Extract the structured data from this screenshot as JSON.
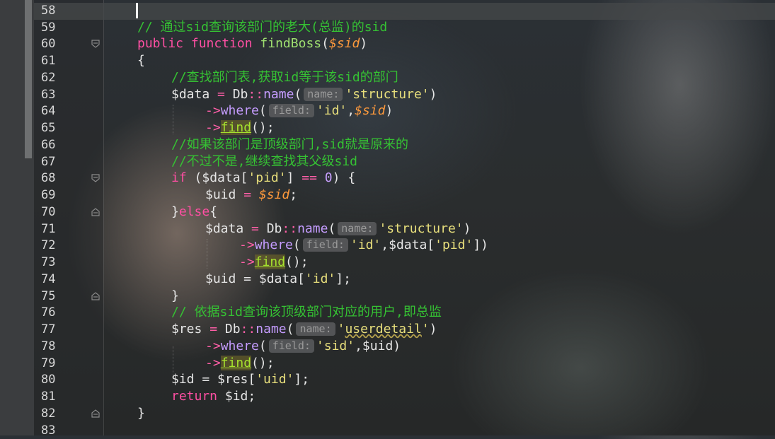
{
  "editor": {
    "line_numbers": [
      "58",
      "59",
      "60",
      "61",
      "62",
      "63",
      "64",
      "65",
      "66",
      "67",
      "68",
      "69",
      "70",
      "71",
      "72",
      "73",
      "74",
      "75",
      "76",
      "77",
      "78",
      "79",
      "80",
      "81",
      "82",
      "83"
    ],
    "code": {
      "l59": {
        "comment": "// 通过sid查询该部门的老大(总监)的sid"
      },
      "l60": {
        "kw1": "public",
        "kw2": "function",
        "name": "findBoss",
        "open": "(",
        "param": "$sid",
        "close": ")"
      },
      "l61": {
        "brace": "{"
      },
      "l62": {
        "comment": "//查找部门表,获取id等于该sid的部门"
      },
      "l63": {
        "var": "$data",
        "eq": " = ",
        "cls": "Db",
        "sep": "::",
        "method": "name",
        "open": "(",
        "hint": "name:",
        "arg": "'structure'",
        "close": ")"
      },
      "l64": {
        "arrow": "->",
        "method": "where",
        "open": "(",
        "hint": "field:",
        "arg": "'id'",
        "comma": ",",
        "param": "$sid",
        "close": ")"
      },
      "l65": {
        "arrow": "->",
        "method": "find",
        "rest": "();"
      },
      "l66": {
        "comment": "//如果该部门是顶级部门,sid就是原来的"
      },
      "l67": {
        "comment": "//不过不是,继续查找其父级sid"
      },
      "l68": {
        "kw": "if",
        "a": " ($data[",
        "str": "'pid'",
        "b": "] ",
        "op": "==",
        "c": " ",
        "num": "0",
        "d": ") {"
      },
      "l69": {
        "var": "$uid",
        "eq": " = ",
        "param": "$sid",
        "end": ";"
      },
      "l70": {
        "a": "}",
        "kw": "else",
        "b": "{"
      },
      "l71": {
        "var": "$data",
        "eq": " = ",
        "cls": "Db",
        "sep": "::",
        "method": "name",
        "open": "(",
        "hint": "name:",
        "arg": "'structure'",
        "close": ")"
      },
      "l72": {
        "arrow": "->",
        "method": "where",
        "open": "(",
        "hint": "field:",
        "arg": "'id'",
        "b": ",$data[",
        "arg2": "'pid'",
        "close": "])"
      },
      "l73": {
        "arrow": "->",
        "method": "find",
        "rest": "();"
      },
      "l74": {
        "a": "$uid = $data[",
        "str": "'id'",
        "b": "];"
      },
      "l75": {
        "brace": "}"
      },
      "l76": {
        "comment": "// 依据sid查询该顶级部门对应的用户,即总监"
      },
      "l77": {
        "var": "$res",
        "eq": " = ",
        "cls": "Db",
        "sep": "::",
        "method": "name",
        "open": "(",
        "hint": "name:",
        "arg_a": "'",
        "arg_b": "userdetail",
        "arg_c": "'",
        "close": ")"
      },
      "l78": {
        "arrow": "->",
        "method": "where",
        "open": "(",
        "hint": "field:",
        "arg": "'sid'",
        "b": ",$uid)"
      },
      "l79": {
        "arrow": "->",
        "method": "find",
        "rest": "();"
      },
      "l80": {
        "a": "$id = $res[",
        "str": "'uid'",
        "b": "];"
      },
      "l81": {
        "kw": "return",
        "b": " $id;"
      },
      "l82": {
        "brace": "}"
      }
    }
  }
}
